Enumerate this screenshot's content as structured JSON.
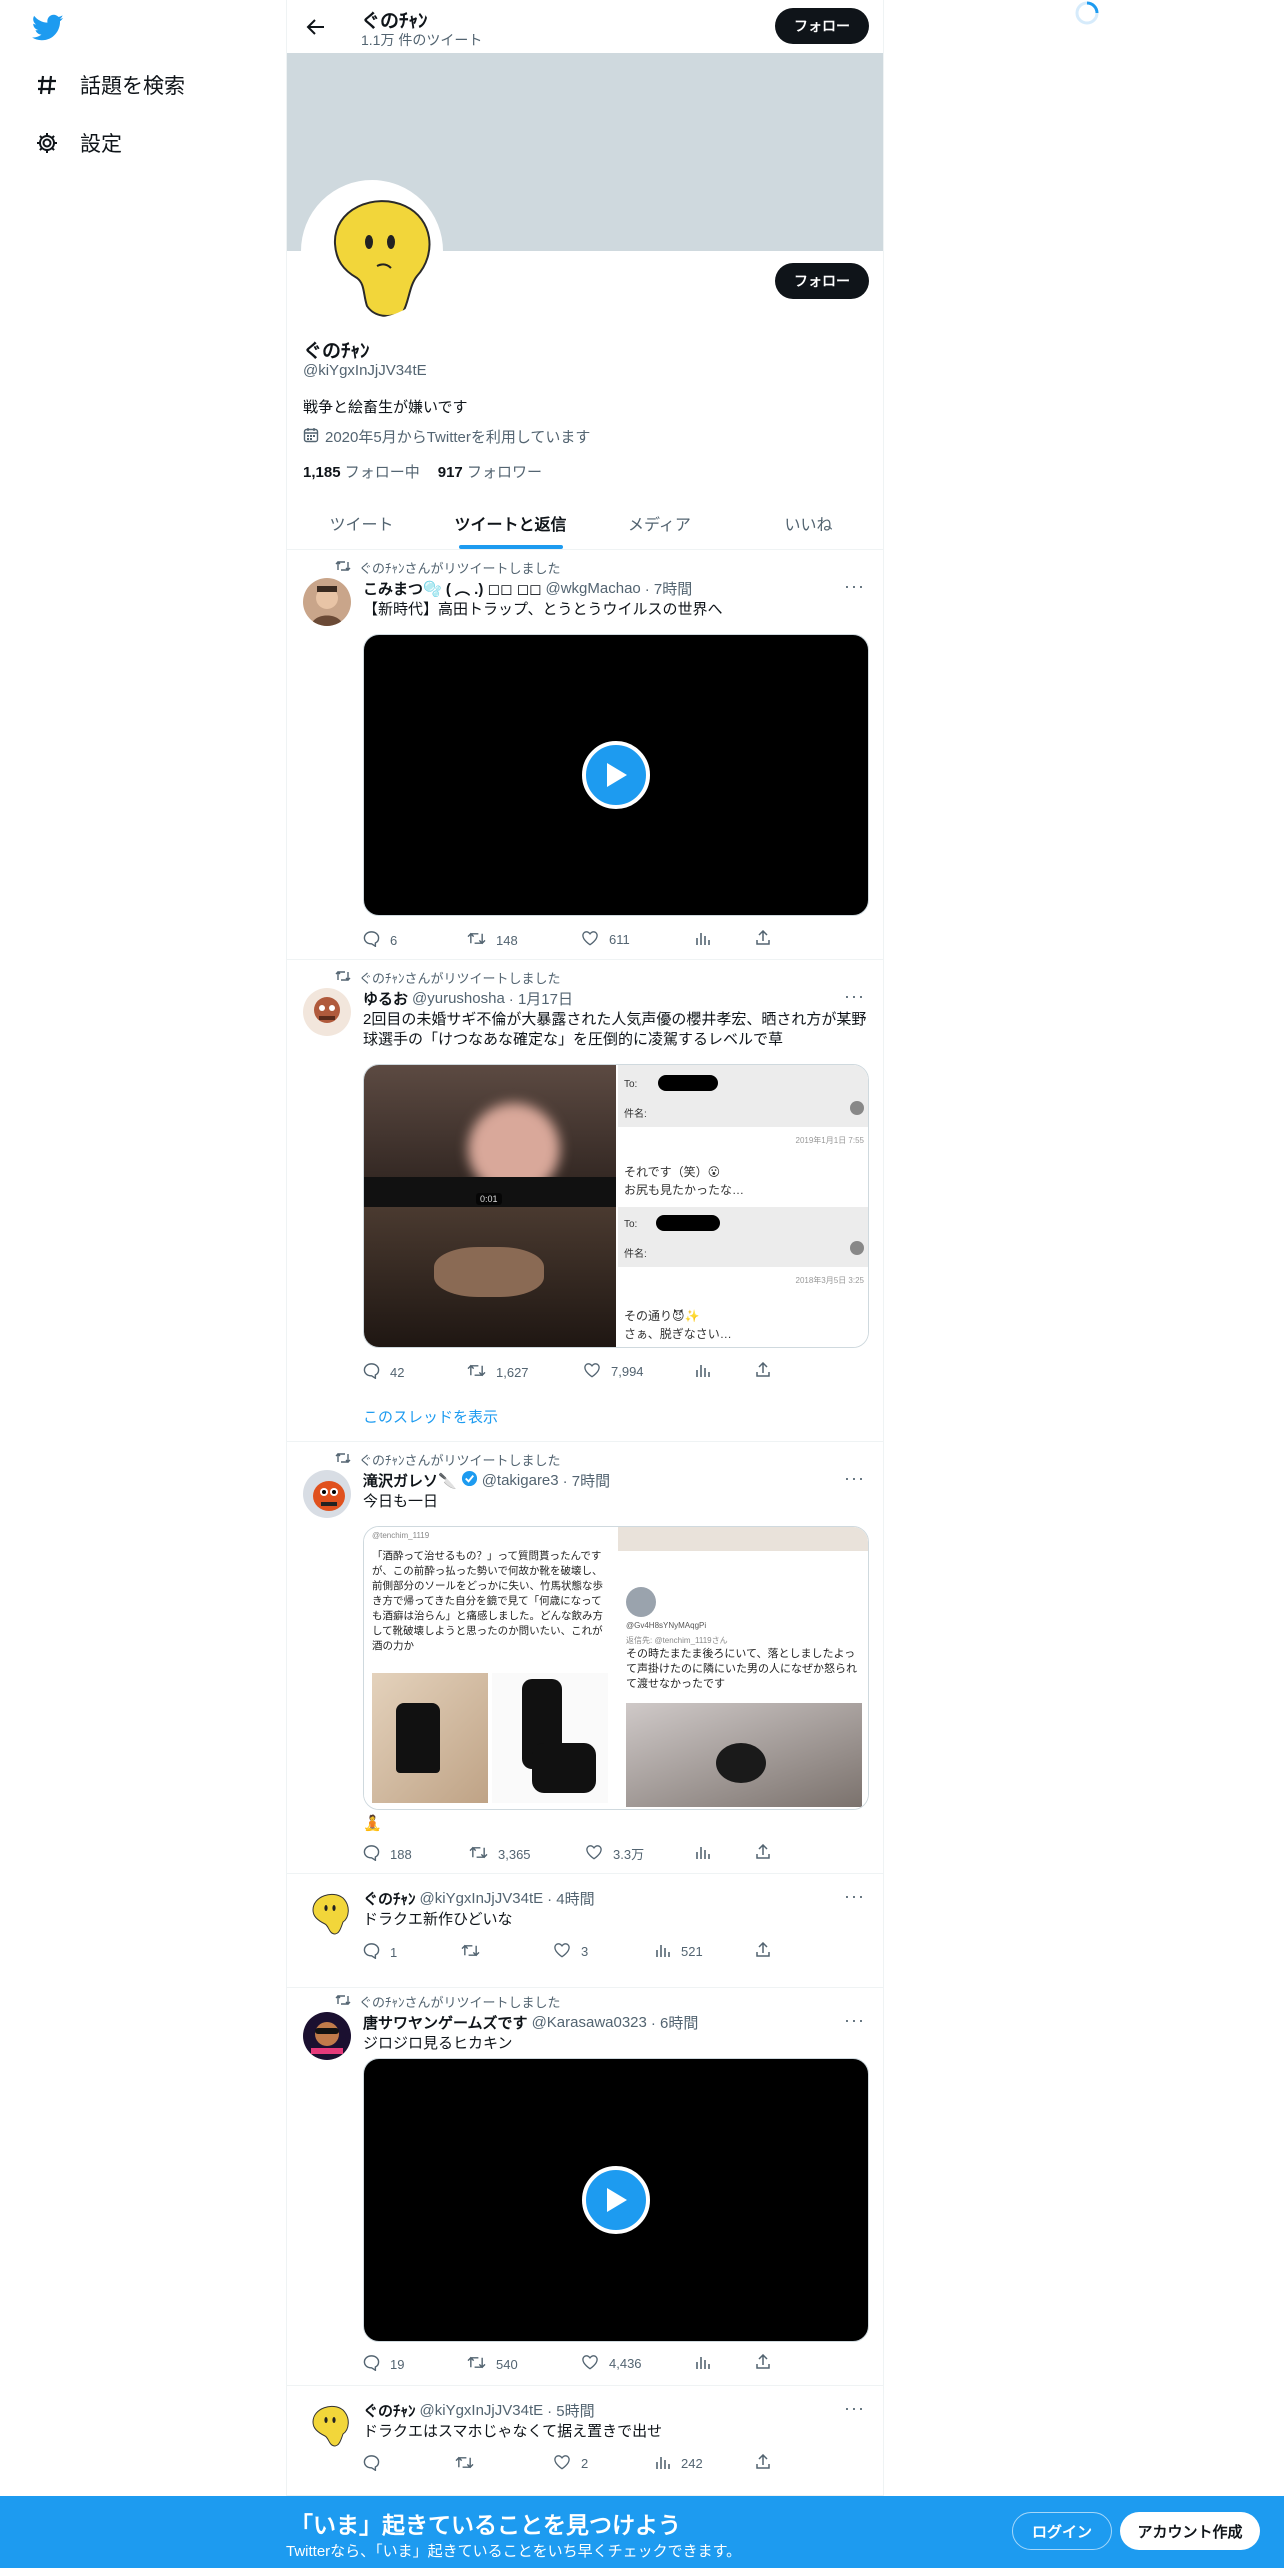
{
  "nav": {
    "items": [
      {
        "icon": "hashtag-icon",
        "label": "話題を検索"
      },
      {
        "icon": "gear-icon",
        "label": "設定"
      }
    ]
  },
  "topbar": {
    "name": "ぐのﾁｬﾝ",
    "tweet_count": "1.1万 件のツイート",
    "follow_label": "フォロー"
  },
  "profile": {
    "name": "ぐのﾁｬﾝ",
    "handle": "@kiYgxInJjJV34tE",
    "bio": "戦争と絵畜生が嫌いです",
    "joined": "2020年5月からTwitterを利用しています",
    "following_count": "1,185",
    "following_label": "フォロー中",
    "followers_count": "917",
    "followers_label": "フォロワー",
    "follow_label": "フォロー"
  },
  "tabs": [
    {
      "label": "ツイート",
      "active": false
    },
    {
      "label": "ツイートと返信",
      "active": true
    },
    {
      "label": "メディア",
      "active": false
    },
    {
      "label": "いいね",
      "active": false
    }
  ],
  "tweets": [
    {
      "retweet_label": "ぐのﾁｬﾝさんがリツイートしました",
      "name": "こみまつ🫧 ( ︵ .) ◻︎◻︎ ◻︎◻︎",
      "handle": "@wkgMachao",
      "time": "· 7時間",
      "text": "【新時代】高田トラップ、とうとうウイルスの世界へ",
      "replies": "6",
      "retweets": "148",
      "likes": "611",
      "views": ""
    },
    {
      "retweet_label": "ぐのﾁｬﾝさんがリツイートしました",
      "name": "ゆるお",
      "handle": "@yurushosha",
      "time": "· 1月17日",
      "text": "2回目の未婚サギ不倫が大暴露された人気声優の櫻井孝宏、晒され方が某野球選手の「けつなあな確定な」を圧倒的に凌駕するレベルで草",
      "replies": "42",
      "retweets": "1,627",
      "likes": "7,994",
      "views": "",
      "show_thread": "このスレッドを表示",
      "image": {
        "duration": "0:01",
        "mail1_to": "To:",
        "mail1_subject": "件名:",
        "mail1_date": "2019年1月1日 7:55",
        "mail1_body1": "それです（笑）😮",
        "mail1_body2": "お尻も見たかったな…",
        "mail2_to": "To:",
        "mail2_subject": "件名:",
        "mail2_date": "2018年3月5日 3:25",
        "mail2_body1": "その通り😈✨",
        "mail2_body2": "さぁ、脱ぎなさい…"
      }
    },
    {
      "retweet_label": "ぐのﾁｬﾝさんがリツイートしました",
      "name": "滝沢ガレソ🔪",
      "handle": "@takigare3",
      "time": "· 7時間",
      "text": "今日も一日",
      "text2": "🧘",
      "replies": "188",
      "retweets": "3,365",
      "likes": "3.3万",
      "views": "",
      "image": {
        "left_text": "「酒酔って治せるもの？」って質問貰ったんですが、この前酔っ払った勢いで何故か靴を破壊し、前側部分のソールをどっかに失い、竹馬状態な歩き方で帰ってきた自分を鏡で見て「何歳になっても酒癖は治らん」と痛感しました。どんな飲み方して靴破壊しようと思ったのか問いたい、これが酒の力か",
        "left_handle": "@tenchim_1119",
        "right_handle": "@Gv4H8sYNyMAqgPi",
        "right_reply": "返信先: @tenchim_1119さん",
        "right_text": "その時たまたま後ろにいて、落としましたよって声掛けたのに隣にいた男の人になぜか怒られて渡せなかったです"
      }
    },
    {
      "retweet_label": "",
      "name": "ぐのﾁｬﾝ",
      "handle": "@kiYgxInJjJV34tE",
      "time": "· 4時間",
      "text": "ドラクエ新作ひどいな",
      "replies": "1",
      "retweets": "",
      "likes": "3",
      "views": "521"
    },
    {
      "retweet_label": "ぐのﾁｬﾝさんがリツイートしました",
      "name": "唐サワヤンゲームズです",
      "handle": "@Karasawa0323",
      "time": "· 6時間",
      "text": "ジロジロ見るヒカキン",
      "replies": "19",
      "retweets": "540",
      "likes": "4,436",
      "views": ""
    },
    {
      "retweet_label": "",
      "name": "ぐのﾁｬﾝ",
      "handle": "@kiYgxInJjJV34tE",
      "time": "· 5時間",
      "text": "ドラクエはスマホじゃなくて据え置きで出せ",
      "replies": "",
      "retweets": "",
      "likes": "2",
      "views": "242"
    }
  ],
  "bottombar": {
    "title": "「いま」起きていることを見つけよう",
    "subtitle": "Twitterなら、「いま」起きていることをいち早くチェックできます。",
    "login": "ログイン",
    "signup": "アカウント作成"
  },
  "colors": {
    "accent": "#1d9bf0",
    "text": "#0f1419",
    "muted": "#536471",
    "banner": "#cfd9de"
  }
}
